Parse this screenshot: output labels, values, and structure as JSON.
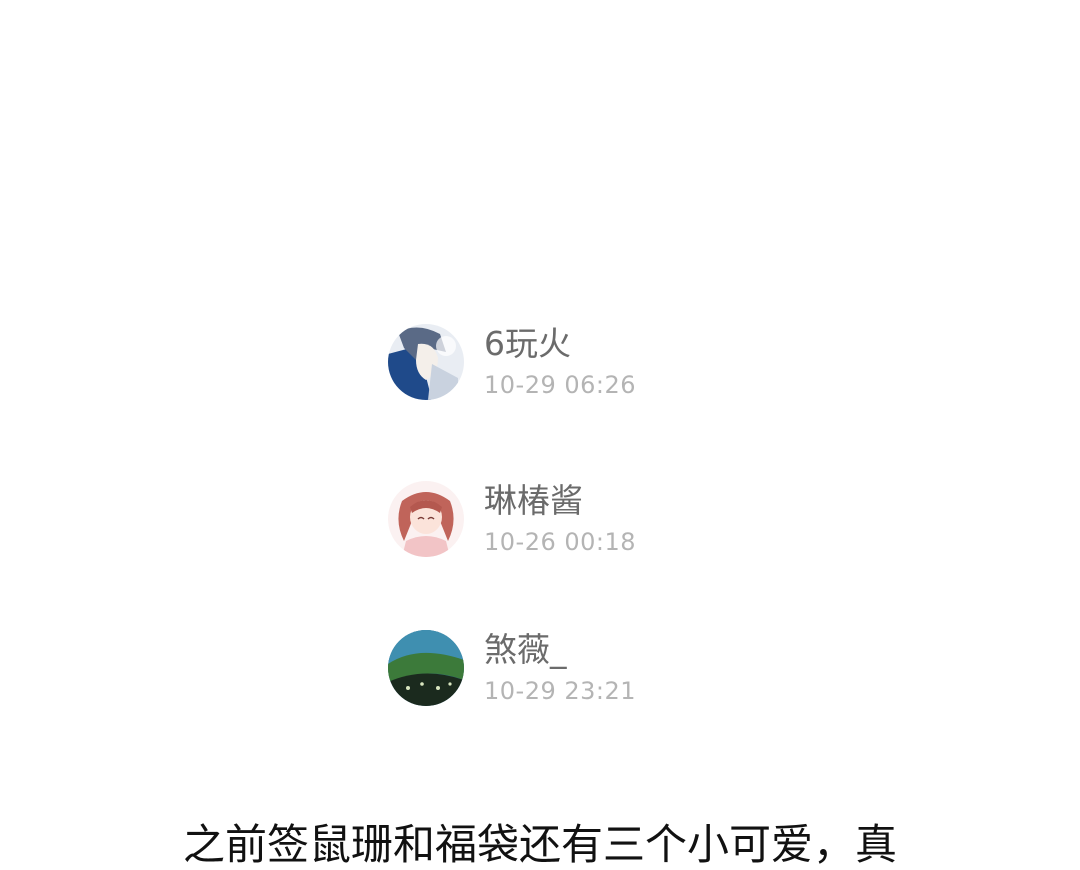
{
  "users": [
    {
      "name": "6玩火",
      "time": "10-29 06:26",
      "avatar_icon": "anime-boy-avatar",
      "avatar_colors": [
        "#1f4a8a",
        "#e8ecf2",
        "#9aa8bd"
      ]
    },
    {
      "name": "琳椿酱",
      "time": "10-26 00:18",
      "avatar_icon": "anime-girl-avatar",
      "avatar_colors": [
        "#fbeff0",
        "#c0645a",
        "#f3c9c9"
      ]
    },
    {
      "name": "煞薇_",
      "time": "10-29 23:21",
      "avatar_icon": "landscape-avatar",
      "avatar_colors": [
        "#2e6f8f",
        "#3c7a3a",
        "#1b2a1e"
      ]
    }
  ],
  "caption": "之前签鼠珊和福袋还有三个小可爱，真"
}
